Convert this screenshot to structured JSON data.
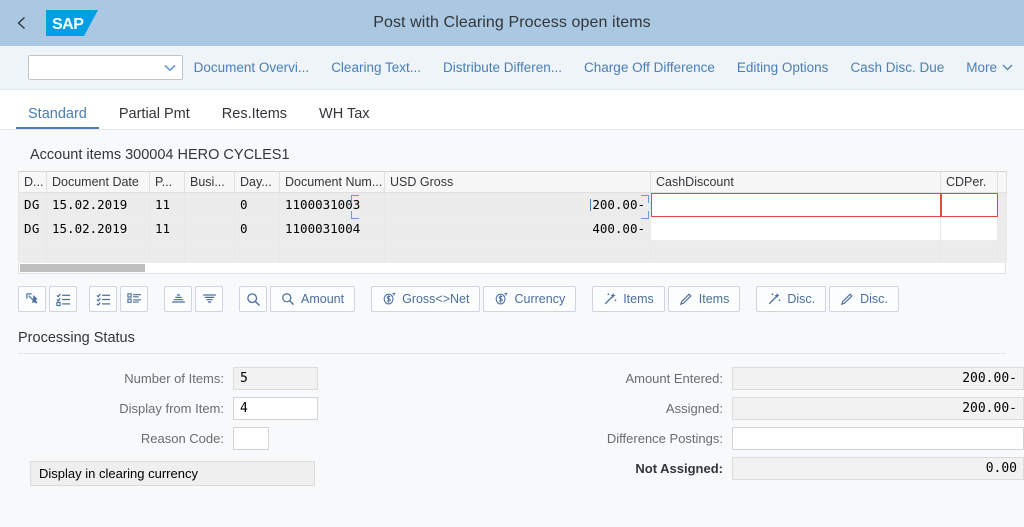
{
  "shell": {
    "back_label": "Back",
    "logo_text": "SAP",
    "title": "Post with Clearing Process open items"
  },
  "toolbar": {
    "variant_value": "",
    "variant_placeholder": "",
    "actions": [
      {
        "label": "Document Overvi...",
        "name": "document-overview-action"
      },
      {
        "label": "Clearing Text...",
        "name": "clearing-text-action"
      },
      {
        "label": "Distribute Differen...",
        "name": "distribute-difference-action"
      },
      {
        "label": "Charge Off Difference",
        "name": "charge-off-difference-action"
      },
      {
        "label": "Editing Options",
        "name": "editing-options-action"
      },
      {
        "label": "Cash Disc. Due",
        "name": "cash-disc-due-action"
      }
    ],
    "more_label": "More"
  },
  "tabs": [
    {
      "label": "Standard",
      "active": true
    },
    {
      "label": "Partial Pmt",
      "active": false
    },
    {
      "label": "Res.Items",
      "active": false
    },
    {
      "label": "WH Tax",
      "active": false
    }
  ],
  "account_section": {
    "title": "Account items 300004 HERO CYCLES1"
  },
  "table": {
    "columns": [
      {
        "key": "doctype",
        "label": "D..."
      },
      {
        "key": "docdate",
        "label": "Document Date"
      },
      {
        "key": "posting",
        "label": "P..."
      },
      {
        "key": "business",
        "label": "Busi..."
      },
      {
        "key": "days",
        "label": "Day..."
      },
      {
        "key": "docnum",
        "label": "Document Num..."
      },
      {
        "key": "usdgross",
        "label": "USD Gross"
      },
      {
        "key": "cashdiscount",
        "label": "CashDiscount"
      },
      {
        "key": "cdper",
        "label": "CDPer."
      }
    ],
    "rows": [
      {
        "doctype": "DG",
        "docdate": "15.02.2019",
        "posting": "11",
        "business": "",
        "days": "0",
        "docnum": "1100031003",
        "usdgross": "200.00-",
        "cashdiscount": "",
        "cdper": "",
        "focused": true,
        "error": true
      },
      {
        "doctype": "DG",
        "docdate": "15.02.2019",
        "posting": "11",
        "business": "",
        "days": "0",
        "docnum": "1100031004",
        "usdgross": "400.00-",
        "cashdiscount": "",
        "cdper": "",
        "focused": false,
        "error": false
      }
    ]
  },
  "item_toolbar": {
    "buttons": [
      {
        "name": "select-all-button",
        "icon": "select-all-icon",
        "label": ""
      },
      {
        "name": "select-items-button",
        "icon": "check-list-icon",
        "label": ""
      },
      {
        "name": "activate-items-button",
        "icon": "check-list-alt-icon",
        "label": ""
      },
      {
        "name": "deactivate-items-button",
        "icon": "bullet-list-icon",
        "label": ""
      },
      {
        "name": "sort-ascending-button",
        "icon": "sort-ascending-icon",
        "label": ""
      },
      {
        "name": "sort-descending-button",
        "icon": "sort-descending-icon",
        "label": ""
      },
      {
        "name": "search-button",
        "icon": "search-icon",
        "label": ""
      },
      {
        "name": "search-amount-button",
        "icon": "search-icon",
        "label": "Amount"
      },
      {
        "name": "gross-net-button",
        "icon": "currency-icon",
        "label": "Gross<>Net"
      },
      {
        "name": "currency-button",
        "icon": "currency-icon",
        "label": "Currency"
      },
      {
        "name": "assign-items-button",
        "icon": "wand-icon",
        "label": "Items"
      },
      {
        "name": "edit-items-button",
        "icon": "pencil-icon",
        "label": "Items"
      },
      {
        "name": "assign-disc-button",
        "icon": "wand-icon",
        "label": "Disc."
      },
      {
        "name": "edit-disc-button",
        "icon": "pencil-icon",
        "label": "Disc."
      }
    ]
  },
  "processing_status": {
    "title": "Processing Status",
    "left_fields": [
      {
        "label": "Number of Items:",
        "value": "5",
        "readonly": true,
        "name": "number-of-items-field",
        "width": "w85"
      },
      {
        "label": "Display from Item:",
        "value": "4",
        "readonly": false,
        "name": "display-from-item-field",
        "width": "w85"
      },
      {
        "label": "Reason Code:",
        "value": "",
        "readonly": false,
        "name": "reason-code-field",
        "width": "w36"
      }
    ],
    "right_fields": [
      {
        "label": "Amount Entered:",
        "value": "200.00-",
        "readonly": true,
        "name": "amount-entered-field",
        "bold": false
      },
      {
        "label": "Assigned:",
        "value": "200.00-",
        "readonly": true,
        "name": "assigned-field",
        "bold": false
      },
      {
        "label": "Difference Postings:",
        "value": "",
        "readonly": false,
        "name": "difference-postings-field",
        "bold": false
      },
      {
        "label": "Not Assigned:",
        "value": "0.00",
        "readonly": true,
        "name": "not-assigned-field",
        "bold": true
      }
    ],
    "currency_banner": "Display in clearing currency"
  },
  "colors": {
    "shell_header": "#abc8e2",
    "sap_logo_blue": "#009ee3",
    "accent_link": "#4a7fb5",
    "error_border": "#e04a3f",
    "row_bg": "#ececec"
  }
}
